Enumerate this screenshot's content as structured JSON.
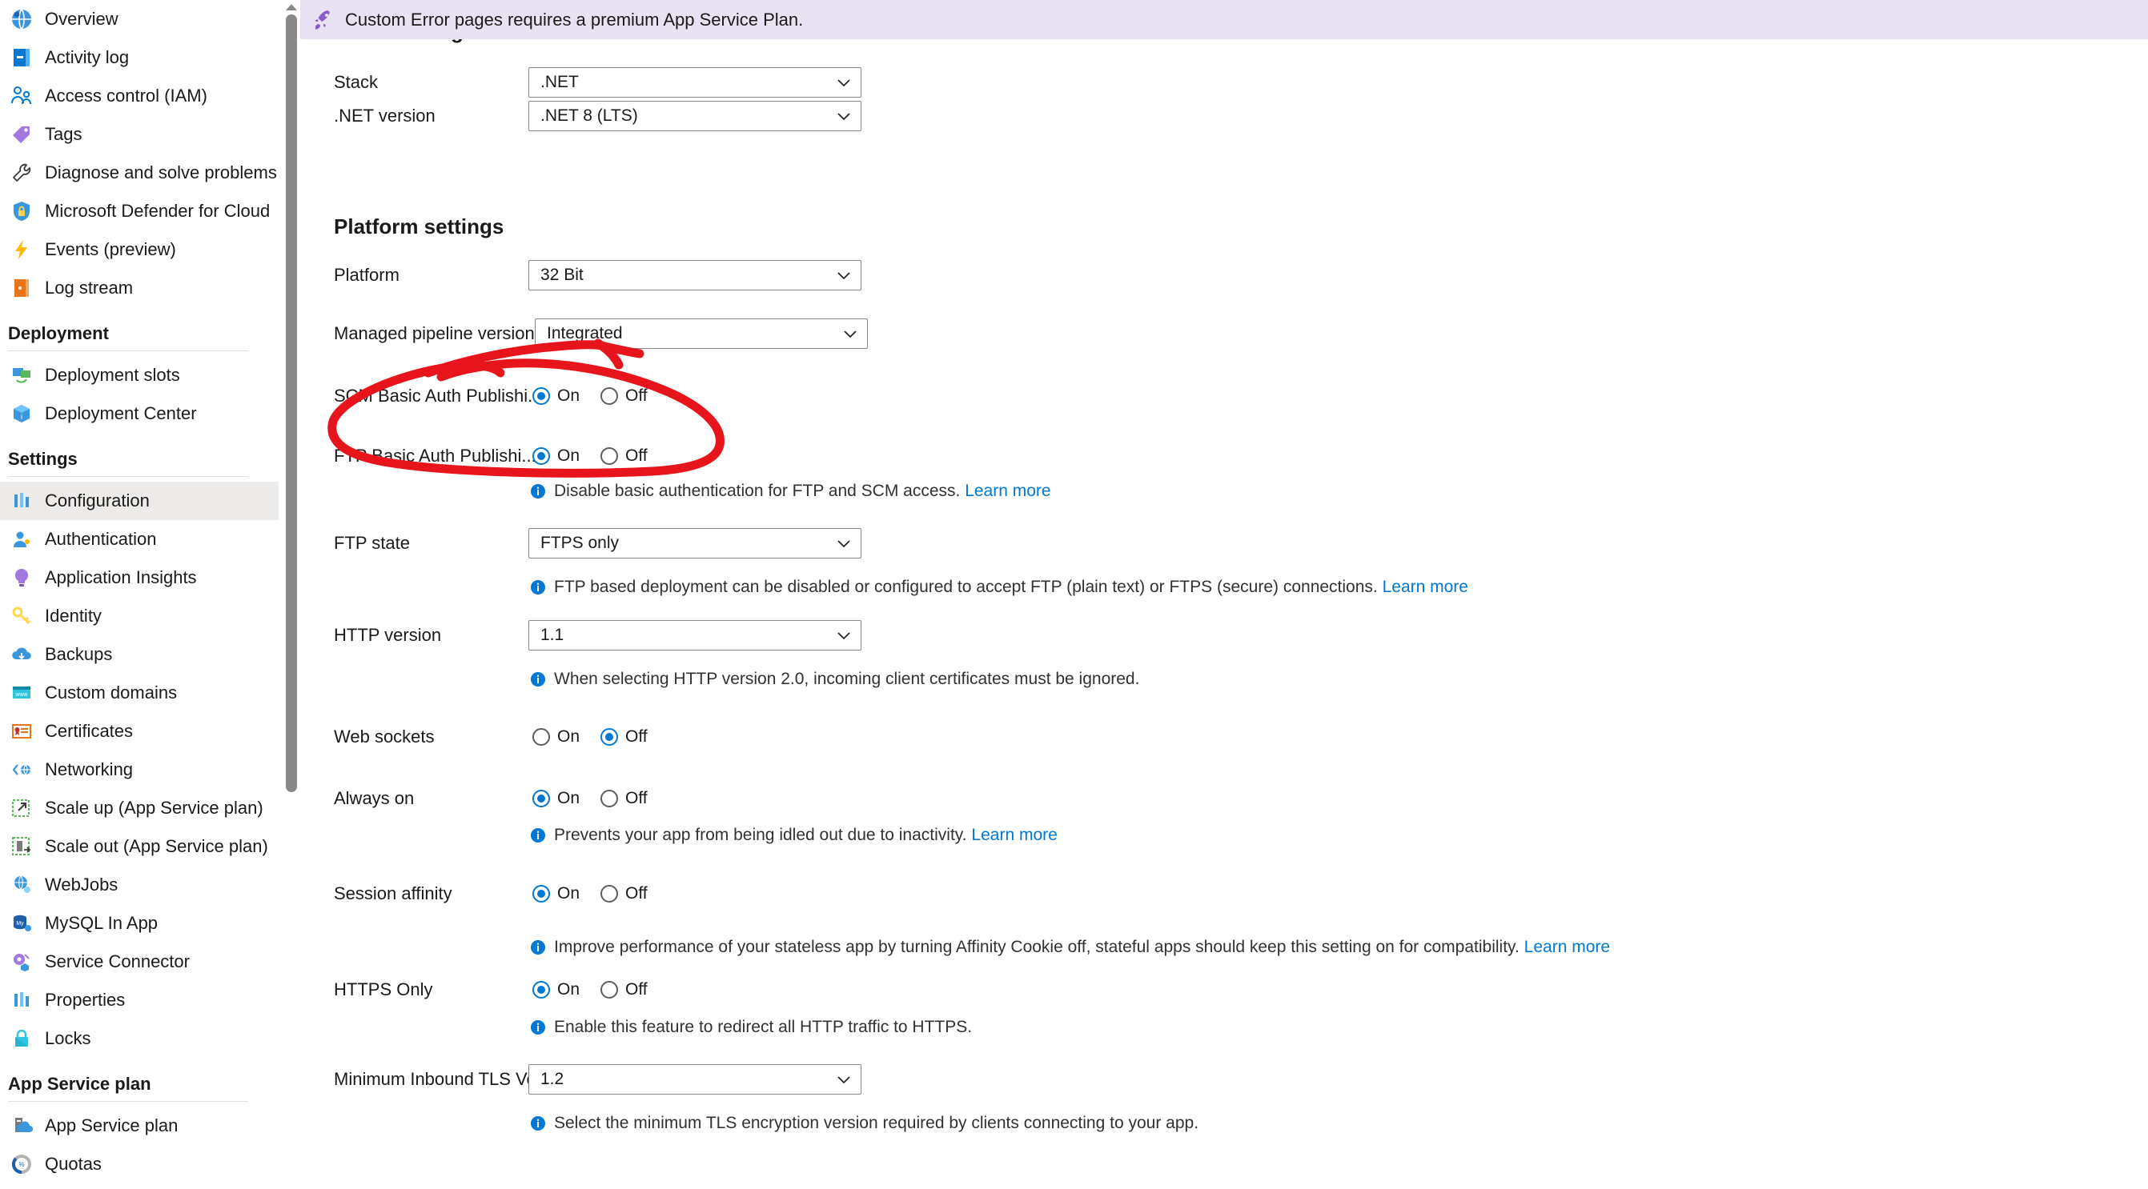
{
  "colors": {
    "accent": "#0078d4",
    "banner_bg": "#e9e2f3",
    "selected_nav_bg": "#edebe9",
    "annotation_red": "#e8141b",
    "link": "#0078d4"
  },
  "banner": {
    "icon": "rocket-icon",
    "message": "Custom Error pages requires a premium App Service Plan."
  },
  "sidebar": {
    "items": [
      {
        "label": "Overview",
        "icon": "globe-icon",
        "selected": false
      },
      {
        "label": "Activity log",
        "icon": "activity-log-icon",
        "selected": false
      },
      {
        "label": "Access control (IAM)",
        "icon": "access-control-icon",
        "selected": false
      },
      {
        "label": "Tags",
        "icon": "tag-icon",
        "selected": false
      },
      {
        "label": "Diagnose and solve problems",
        "icon": "wrench-icon",
        "selected": false
      },
      {
        "label": "Microsoft Defender for Cloud",
        "icon": "shield-lock-icon",
        "selected": false
      },
      {
        "label": "Events (preview)",
        "icon": "lightning-icon",
        "selected": false
      },
      {
        "label": "Log stream",
        "icon": "log-stream-icon",
        "selected": false
      }
    ],
    "groups": [
      {
        "title": "Deployment",
        "items": [
          {
            "label": "Deployment slots",
            "icon": "deployment-slots-icon",
            "selected": false
          },
          {
            "label": "Deployment Center",
            "icon": "deployment-center-icon",
            "selected": false
          }
        ]
      },
      {
        "title": "Settings",
        "items": [
          {
            "label": "Configuration",
            "icon": "configuration-icon",
            "selected": true
          },
          {
            "label": "Authentication",
            "icon": "authentication-icon",
            "selected": false
          },
          {
            "label": "Application Insights",
            "icon": "app-insights-icon",
            "selected": false
          },
          {
            "label": "Identity",
            "icon": "key-icon",
            "selected": false
          },
          {
            "label": "Backups",
            "icon": "backup-cloud-icon",
            "selected": false
          },
          {
            "label": "Custom domains",
            "icon": "custom-domains-icon",
            "selected": false
          },
          {
            "label": "Certificates",
            "icon": "certificate-icon",
            "selected": false
          },
          {
            "label": "Networking",
            "icon": "networking-icon",
            "selected": false
          },
          {
            "label": "Scale up (App Service plan)",
            "icon": "scale-up-icon",
            "selected": false
          },
          {
            "label": "Scale out (App Service plan)",
            "icon": "scale-out-icon",
            "selected": false
          },
          {
            "label": "WebJobs",
            "icon": "webjobs-icon",
            "selected": false
          },
          {
            "label": "MySQL In App",
            "icon": "mysql-icon",
            "selected": false
          },
          {
            "label": "Service Connector",
            "icon": "service-connector-icon",
            "selected": false
          },
          {
            "label": "Properties",
            "icon": "properties-icon",
            "selected": false
          },
          {
            "label": "Locks",
            "icon": "lock-icon",
            "selected": false
          }
        ]
      },
      {
        "title": "App Service plan",
        "items": [
          {
            "label": "App Service plan",
            "icon": "app-service-plan-icon",
            "selected": false
          },
          {
            "label": "Quotas",
            "icon": "quotas-icon",
            "selected": false
          }
        ]
      }
    ]
  },
  "main": {
    "stack_settings_heading": "Stack settings",
    "platform_settings_heading": "Platform settings",
    "rows": {
      "stack": {
        "label": "Stack",
        "value": ".NET"
      },
      "dotnet_version": {
        "label": ".NET version",
        "value": ".NET 8 (LTS)"
      },
      "platform": {
        "label": "Platform",
        "value": "32 Bit"
      },
      "managed_pipeline_version": {
        "label": "Managed pipeline version",
        "value": "Integrated"
      },
      "scm_basic_auth": {
        "label": "SCM Basic Auth Publishi...",
        "on_label": "On",
        "off_label": "Off",
        "selected": "On"
      },
      "ftp_basic_auth": {
        "label": "FTP Basic Auth Publishi...",
        "on_label": "On",
        "off_label": "Off",
        "selected": "On",
        "info": "Disable basic authentication for FTP and SCM access.",
        "info_link": "Learn more"
      },
      "ftp_state": {
        "label": "FTP state",
        "value": "FTPS only",
        "info": "FTP based deployment can be disabled or configured to accept FTP (plain text) or FTPS (secure) connections.",
        "info_link": "Learn more"
      },
      "http_version": {
        "label": "HTTP version",
        "value": "1.1",
        "info": "When selecting HTTP version 2.0, incoming client certificates must be ignored."
      },
      "web_sockets": {
        "label": "Web sockets",
        "on_label": "On",
        "off_label": "Off",
        "selected": "Off"
      },
      "always_on": {
        "label": "Always on",
        "on_label": "On",
        "off_label": "Off",
        "selected": "On",
        "info": "Prevents your app from being idled out due to inactivity.",
        "info_link": "Learn more"
      },
      "session_affinity": {
        "label": "Session affinity",
        "on_label": "On",
        "off_label": "Off",
        "selected": "On",
        "info": "Improve performance of your stateless app by turning Affinity Cookie off, stateful apps should keep this setting on for compatibility.",
        "info_link": "Learn more"
      },
      "https_only": {
        "label": "HTTPS Only",
        "on_label": "On",
        "off_label": "Off",
        "selected": "On",
        "info": "Enable this feature to redirect all HTTP traffic to HTTPS."
      },
      "min_tls": {
        "label": "Minimum Inbound TLS Versi...",
        "value": "1.2",
        "info": "Select the minimum TLS encryption version required by clients connecting to your app."
      }
    }
  },
  "annotation": {
    "shape": "hand-drawn-ellipse",
    "target": "SCM Basic Auth Publishing row",
    "color": "#e8141b"
  }
}
